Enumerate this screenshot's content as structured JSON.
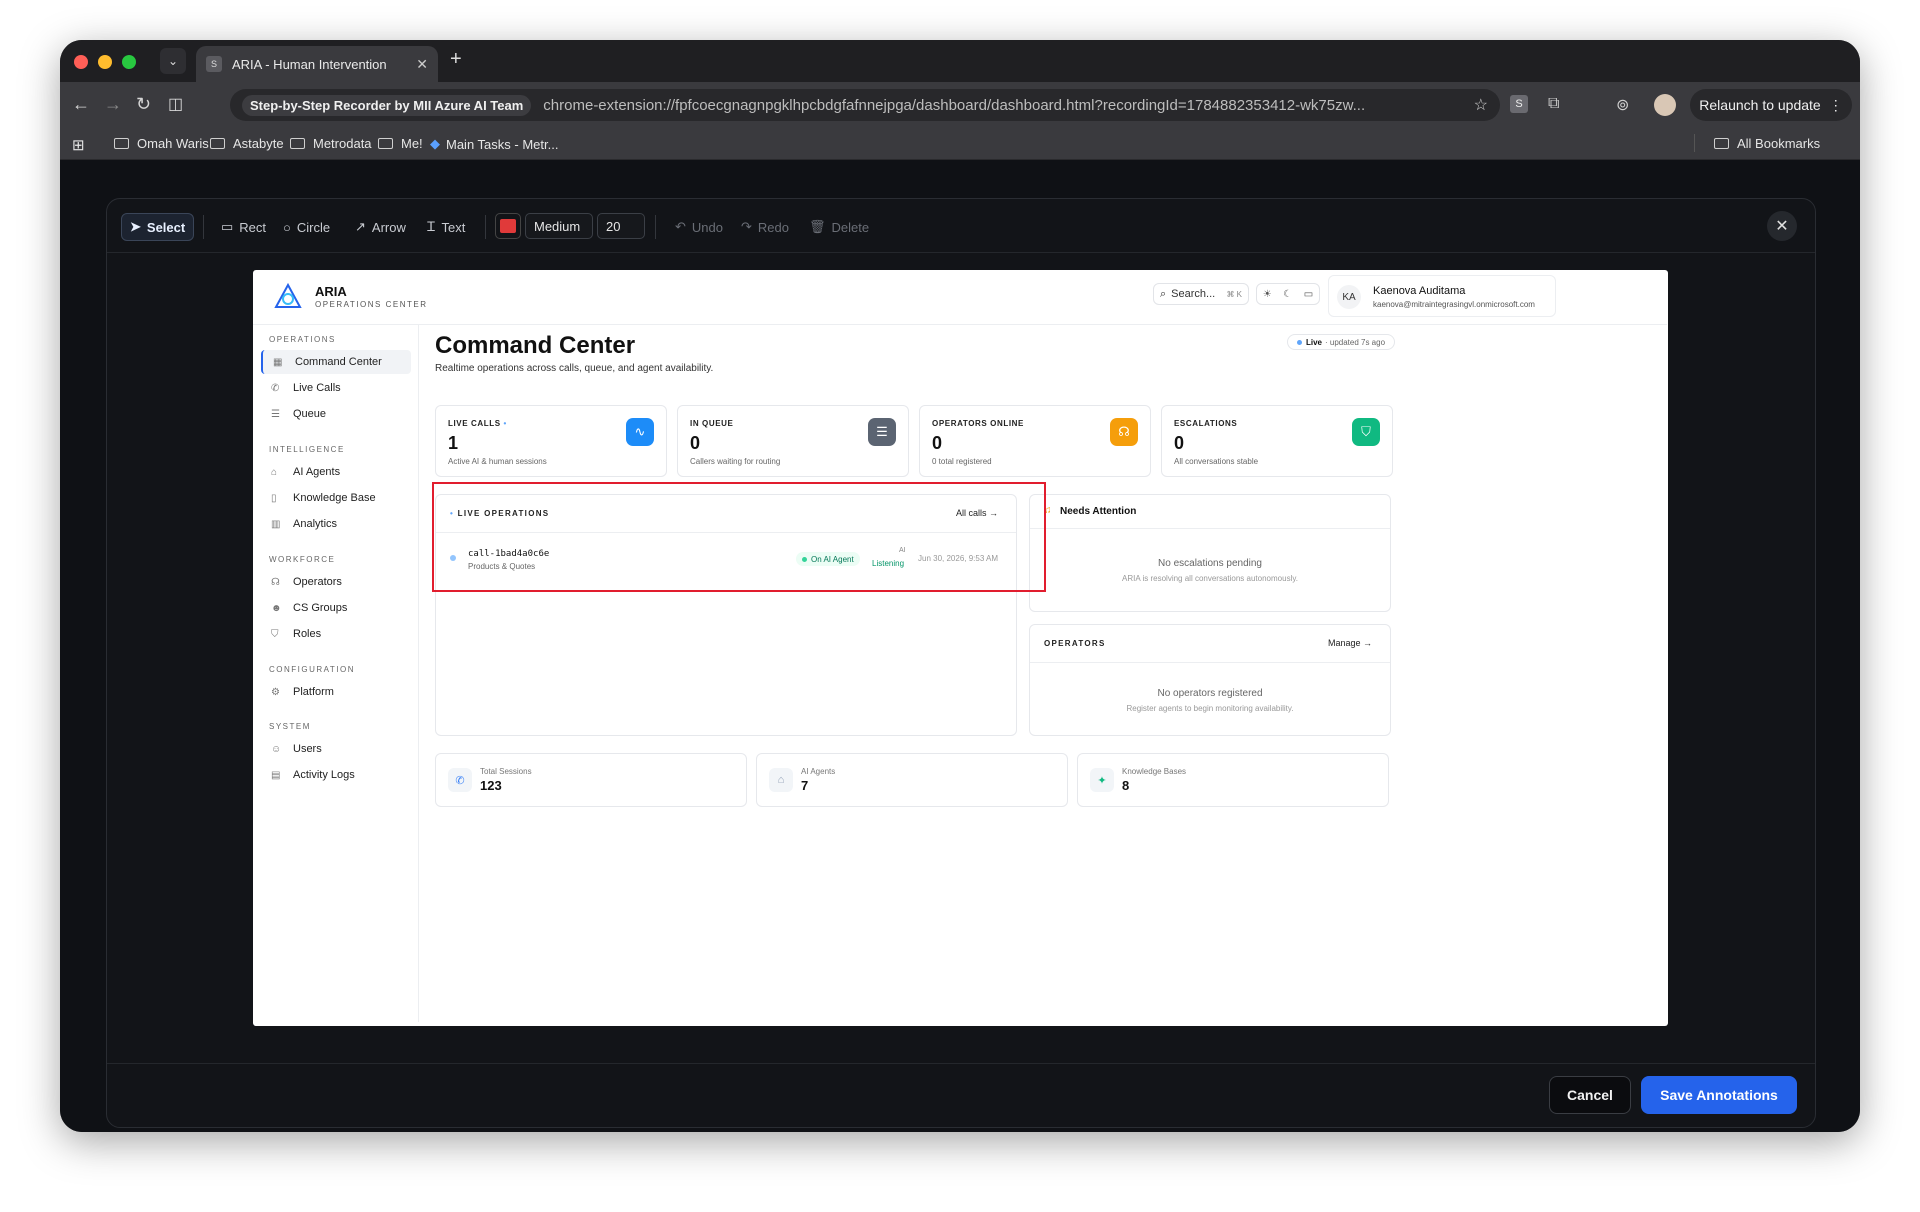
{
  "browser": {
    "tab_title": "ARIA - Human Intervention",
    "tab_favicon": "S",
    "extension_chip": "Step-by-Step Recorder by MII Azure AI Team",
    "url": "chrome-extension://fpfcoecgnagnpgklhpcbdgfafnnejpga/dashboard/dashboard.html?recordingId=1784882353412-wk75zw...",
    "relaunch_label": "Relaunch to update",
    "extension_s": "S",
    "bookmarks": [
      "Omah Waris",
      "Astabyte",
      "Metrodata",
      "Me!",
      "Main Tasks - Metr..."
    ],
    "all_bookmarks": "All Bookmarks"
  },
  "annotation_toolbar": {
    "select": "Select",
    "rect": "Rect",
    "circle": "Circle",
    "arrow": "Arrow",
    "text": "Text",
    "stroke_width": "Medium",
    "font_size": "20",
    "undo": "Undo",
    "redo": "Redo",
    "delete": "Delete",
    "color": "#e03a3a"
  },
  "footer": {
    "cancel": "Cancel",
    "save": "Save Annotations"
  },
  "app": {
    "brand": "ARIA",
    "brand_sub": "OPERATIONS CENTER",
    "search_placeholder": "Search...",
    "search_kbd": "⌘ K",
    "user_initials": "KA",
    "user_name": "Kaenova Auditama",
    "user_email": "kaenova@mitraintegrasingvl.onmicrosoft.com"
  },
  "sidebar": {
    "sections": [
      {
        "title": "OPERATIONS",
        "items": [
          "Command Center",
          "Live Calls",
          "Queue"
        ]
      },
      {
        "title": "INTELLIGENCE",
        "items": [
          "AI Agents",
          "Knowledge Base",
          "Analytics"
        ]
      },
      {
        "title": "WORKFORCE",
        "items": [
          "Operators",
          "CS Groups",
          "Roles"
        ]
      },
      {
        "title": "CONFIGURATION",
        "items": [
          "Platform"
        ]
      },
      {
        "title": "SYSTEM",
        "items": [
          "Users",
          "Activity Logs"
        ]
      }
    ]
  },
  "main": {
    "title": "Command Center",
    "subtitle": "Realtime operations across calls, queue, and agent availability.",
    "live_label": "Live",
    "live_updated": "· updated 7s ago",
    "stats": [
      {
        "label": "LIVE CALLS",
        "value": "1",
        "desc": "Active AI & human sessions",
        "color": "#1d8cf8"
      },
      {
        "label": "IN QUEUE",
        "value": "0",
        "desc": "Callers waiting for routing",
        "color": "#5b6472"
      },
      {
        "label": "OPERATORS ONLINE",
        "value": "0",
        "desc": "0 total registered",
        "color": "#f59e0b"
      },
      {
        "label": "ESCALATIONS",
        "value": "0",
        "desc": "All conversations stable",
        "color": "#10b981"
      }
    ],
    "live_ops": {
      "title": "LIVE OPERATIONS",
      "link": "All calls →",
      "call_id": "call-1bad4a0c6e",
      "call_category": "Products & Quotes",
      "status_tag": "On AI Agent",
      "mode_label": "AI",
      "mode_state": "Listening",
      "time": "Jun 30, 2026, 9:53 AM"
    },
    "needs_attention": {
      "title": "Needs Attention",
      "empty_title": "No escalations pending",
      "empty_sub": "ARIA is resolving all conversations autonomously."
    },
    "operators": {
      "title": "OPERATORS",
      "link": "Manage →",
      "empty_title": "No operators registered",
      "empty_sub": "Register agents to begin monitoring availability."
    },
    "metrics": [
      {
        "label": "Total Sessions",
        "value": "123"
      },
      {
        "label": "AI Agents",
        "value": "7"
      },
      {
        "label": "Knowledge Bases",
        "value": "8"
      }
    ]
  }
}
